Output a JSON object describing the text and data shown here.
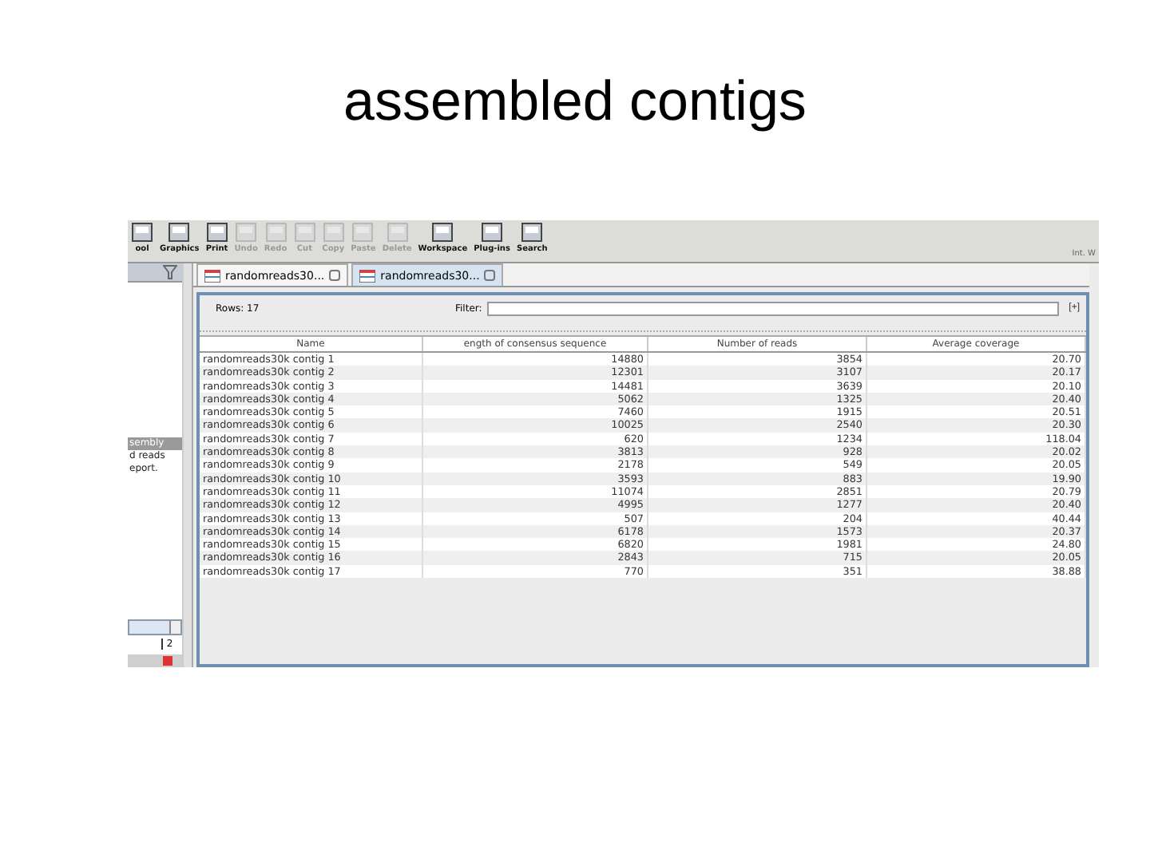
{
  "slide_title": "assembled contigs",
  "toolbar": {
    "buttons": [
      {
        "label": "ool",
        "disabled": false
      },
      {
        "label": "Graphics",
        "disabled": false
      },
      {
        "label": "Print",
        "disabled": false
      },
      {
        "label": "Undo",
        "disabled": true
      },
      {
        "label": "Redo",
        "disabled": true
      },
      {
        "label": "Cut",
        "disabled": true
      },
      {
        "label": "Copy",
        "disabled": true
      },
      {
        "label": "Paste",
        "disabled": true
      },
      {
        "label": "Delete",
        "disabled": true
      },
      {
        "label": "Workspace",
        "disabled": false
      },
      {
        "label": "Plug-ins",
        "disabled": false
      },
      {
        "label": "Search",
        "disabled": false
      }
    ],
    "right_label": "Int. W"
  },
  "left_panel": {
    "items": [
      {
        "label": "sembly",
        "selected": true
      },
      {
        "label": "d reads",
        "selected": false
      },
      {
        "label": "eport.",
        "selected": false
      }
    ],
    "footer_value": "2"
  },
  "tabs": [
    {
      "label": "randomreads30...",
      "selected": false
    },
    {
      "label": "randomreads30...",
      "selected": true
    }
  ],
  "rows_label": "Rows: 17",
  "filter": {
    "label": "Filter:",
    "button": "[+]"
  },
  "table": {
    "columns": [
      "Name",
      "ength of consensus sequence",
      "Number of reads",
      "Average coverage"
    ],
    "rows": [
      [
        "randomreads30k contig 1",
        "14880",
        "3854",
        "20.70"
      ],
      [
        "randomreads30k contig 2",
        "12301",
        "3107",
        "20.17"
      ],
      [
        "randomreads30k contig 3",
        "14481",
        "3639",
        "20.10"
      ],
      [
        "randomreads30k contig 4",
        "5062",
        "1325",
        "20.40"
      ],
      [
        "randomreads30k contig 5",
        "7460",
        "1915",
        "20.51"
      ],
      [
        "randomreads30k contig 6",
        "10025",
        "2540",
        "20.30"
      ],
      [
        "randomreads30k contig 7",
        "620",
        "1234",
        "118.04"
      ],
      [
        "randomreads30k contig 8",
        "3813",
        "928",
        "20.02"
      ],
      [
        "randomreads30k contig 9",
        "2178",
        "549",
        "20.05"
      ],
      [
        "randomreads30k contig 10",
        "3593",
        "883",
        "19.90"
      ],
      [
        "randomreads30k contig 11",
        "11074",
        "2851",
        "20.79"
      ],
      [
        "randomreads30k contig 12",
        "4995",
        "1277",
        "20.40"
      ],
      [
        "randomreads30k contig 13",
        "507",
        "204",
        "40.44"
      ],
      [
        "randomreads30k contig 14",
        "6178",
        "1573",
        "20.37"
      ],
      [
        "randomreads30k contig 15",
        "6820",
        "1981",
        "24.80"
      ],
      [
        "randomreads30k contig 16",
        "2843",
        "715",
        "20.05"
      ],
      [
        "randomreads30k contig 17",
        "770",
        "351",
        "38.88"
      ]
    ]
  }
}
